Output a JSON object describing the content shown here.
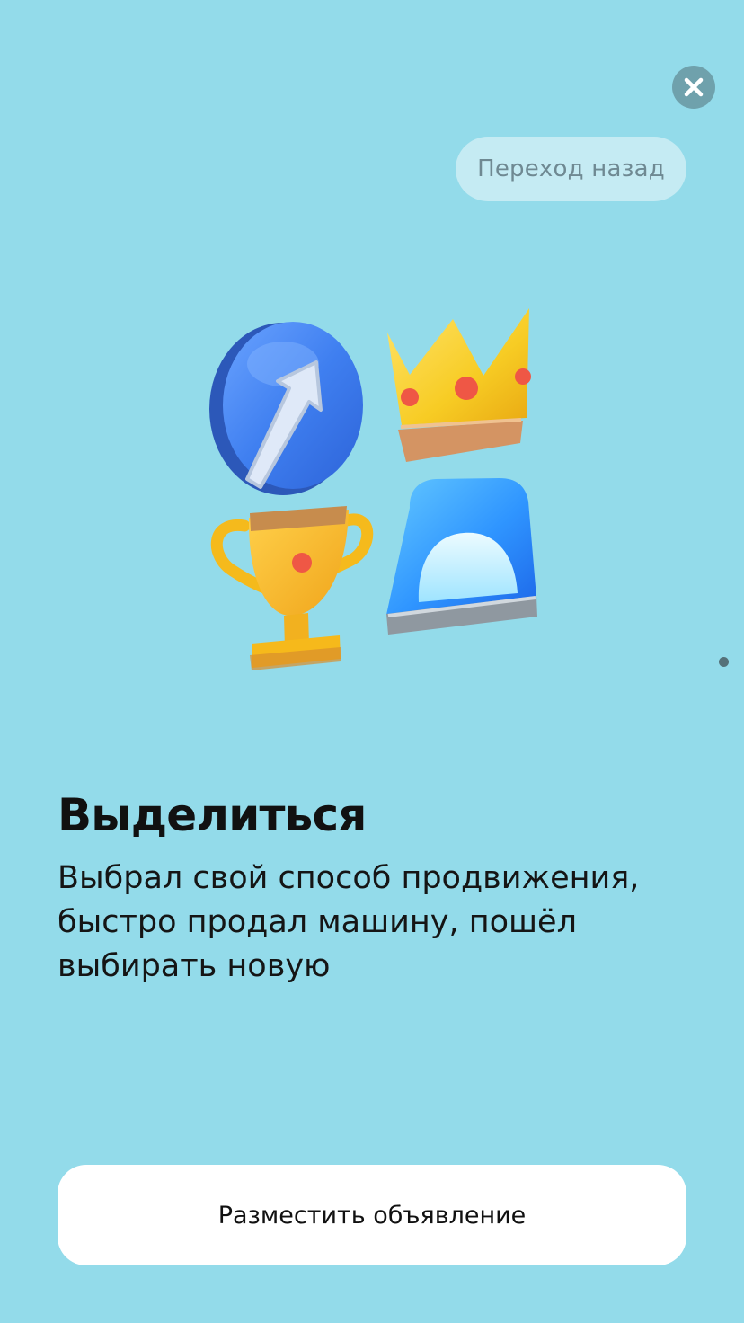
{
  "header": {
    "close_icon": "close-icon",
    "back_label": "Переход назад"
  },
  "illustration": {
    "icons": [
      "arrow-up-right-icon",
      "crown-icon",
      "trophy-icon",
      "siren-icon"
    ]
  },
  "pager": {
    "active_index": 0
  },
  "content": {
    "title": "Выделиться",
    "description": "Выбрал свой способ продвижения, быстро продал машину, пошёл выбирать новую"
  },
  "footer": {
    "cta_label": "Разместить объявление"
  },
  "colors": {
    "background": "#93dbea",
    "close_button": "#6fa1ac",
    "back_pill": "#c5ebf3",
    "cta_background": "#ffffff",
    "text": "#111111"
  }
}
